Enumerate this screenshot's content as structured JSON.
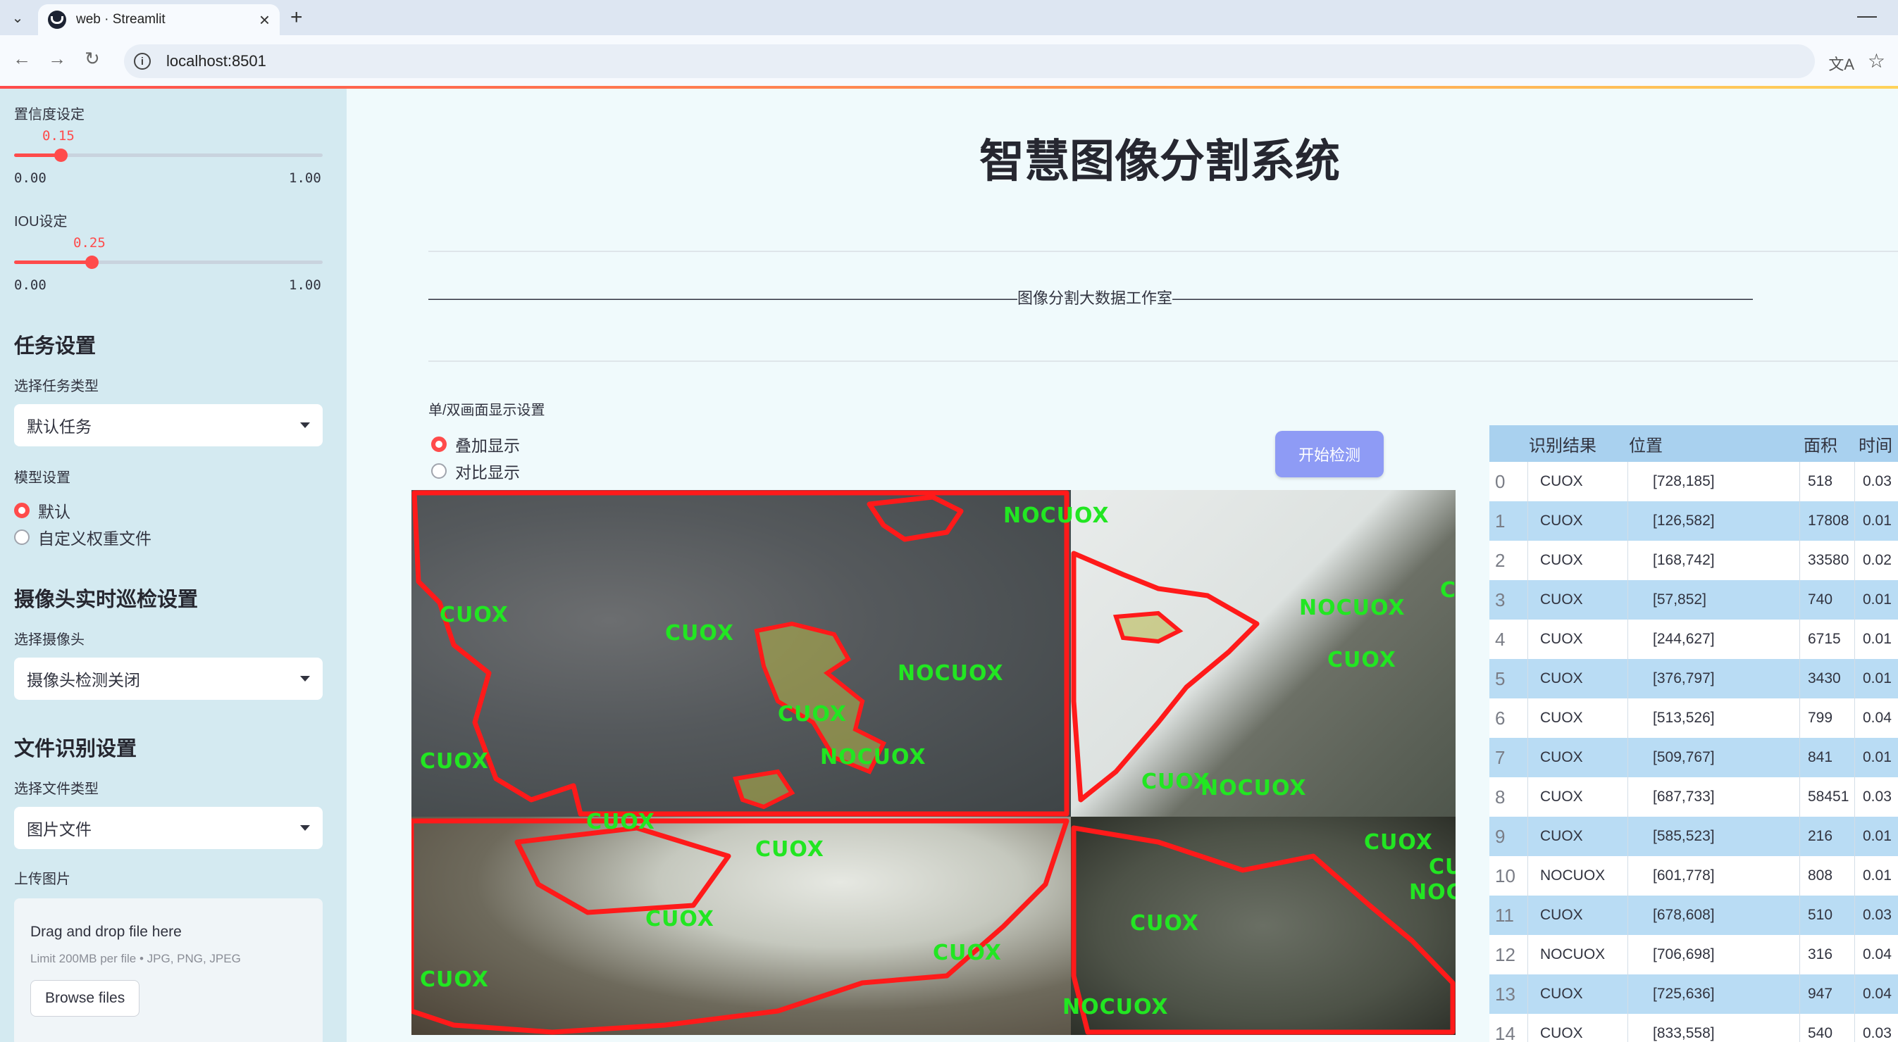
{
  "browser": {
    "tab_title": "web · Streamlit",
    "url": "localhost:8501",
    "new_tab_symbol": "+",
    "minimize_symbol": "—"
  },
  "sidebar": {
    "confidence": {
      "label": "置信度设定",
      "value": "0.15",
      "min": "0.00",
      "max": "1.00",
      "fraction": 0.15
    },
    "iou": {
      "label": "IOU设定",
      "value": "0.25",
      "min": "0.00",
      "max": "1.00",
      "fraction": 0.25
    },
    "task": {
      "heading": "任务设置",
      "label": "选择任务类型",
      "selected": "默认任务"
    },
    "model": {
      "label": "模型设置",
      "options": [
        "默认",
        "自定义权重文件"
      ],
      "selected_index": 0
    },
    "camera": {
      "heading": "摄像头实时巡检设置",
      "label": "选择摄像头",
      "selected": "摄像头检测关闭"
    },
    "file": {
      "heading": "文件识别设置",
      "label": "选择文件类型",
      "selected": "图片文件"
    },
    "upload": {
      "label": "上传图片",
      "drop_text": "Drag and drop file here",
      "limit_text": "Limit 200MB per file • JPG, PNG, JPEG",
      "browse_label": "Browse files"
    }
  },
  "main": {
    "title": "智慧图像分割系统",
    "divider_text": "——————————————————————————————————————图像分割大数据工作室——————————————————————————————————————",
    "display_label": "单/双画面显示设置",
    "display_options": [
      "叠加显示",
      "对比显示"
    ],
    "display_selected": 0,
    "detect_button": "开始检测"
  },
  "segments": [
    {
      "text": "NOCUOX"
    },
    {
      "text": "CUOX"
    },
    {
      "text": "NOCUOX"
    },
    {
      "text": "NOCUOX"
    },
    {
      "text": "CUOX"
    },
    {
      "text": "CUOX"
    },
    {
      "text": "NOCUOX"
    },
    {
      "text": "CUOX"
    },
    {
      "text": "CUOX"
    },
    {
      "text": "NOCUOX"
    },
    {
      "text": "CUOX"
    },
    {
      "text": "CUOX"
    },
    {
      "text": "CUOX"
    },
    {
      "text": "CUOX"
    },
    {
      "text": "CUOX"
    },
    {
      "text": "CUOX"
    },
    {
      "text": "CUOX"
    },
    {
      "text": "NOCUOX"
    },
    {
      "text": "CUOX"
    },
    {
      "text": "NOCUOX"
    },
    {
      "text": "CUOX"
    },
    {
      "text": "CUOX"
    }
  ],
  "table": {
    "headers": [
      "识别结果",
      "位置",
      "面积",
      "时间"
    ],
    "rows": [
      {
        "idx": "0",
        "cls": "CUOX",
        "pos": "[728,185]",
        "area": "518",
        "time": "0.03"
      },
      {
        "idx": "1",
        "cls": "CUOX",
        "pos": "[126,582]",
        "area": "17808",
        "time": "0.01"
      },
      {
        "idx": "2",
        "cls": "CUOX",
        "pos": "[168,742]",
        "area": "33580",
        "time": "0.02"
      },
      {
        "idx": "3",
        "cls": "CUOX",
        "pos": "[57,852]",
        "area": "740",
        "time": "0.01"
      },
      {
        "idx": "4",
        "cls": "CUOX",
        "pos": "[244,627]",
        "area": "6715",
        "time": "0.01"
      },
      {
        "idx": "5",
        "cls": "CUOX",
        "pos": "[376,797]",
        "area": "3430",
        "time": "0.01"
      },
      {
        "idx": "6",
        "cls": "CUOX",
        "pos": "[513,526]",
        "area": "799",
        "time": "0.04"
      },
      {
        "idx": "7",
        "cls": "CUOX",
        "pos": "[509,767]",
        "area": "841",
        "time": "0.01"
      },
      {
        "idx": "8",
        "cls": "CUOX",
        "pos": "[687,733]",
        "area": "58451",
        "time": "0.03"
      },
      {
        "idx": "9",
        "cls": "CUOX",
        "pos": "[585,523]",
        "area": "216",
        "time": "0.01"
      },
      {
        "idx": "10",
        "cls": "NOCUOX",
        "pos": "[601,778]",
        "area": "808",
        "time": "0.01"
      },
      {
        "idx": "11",
        "cls": "CUOX",
        "pos": "[678,608]",
        "area": "510",
        "time": "0.03"
      },
      {
        "idx": "12",
        "cls": "NOCUOX",
        "pos": "[706,698]",
        "area": "316",
        "time": "0.04"
      },
      {
        "idx": "13",
        "cls": "CUOX",
        "pos": "[725,636]",
        "area": "947",
        "time": "0.04"
      },
      {
        "idx": "14",
        "cls": "CUOX",
        "pos": "[833,558]",
        "area": "540",
        "time": "0.03"
      }
    ]
  },
  "colors": {
    "accent": "#ff4b4b",
    "button": "#8e9bf5",
    "segment_outline": "#ff1a1a",
    "segment_label": "#22e622"
  }
}
